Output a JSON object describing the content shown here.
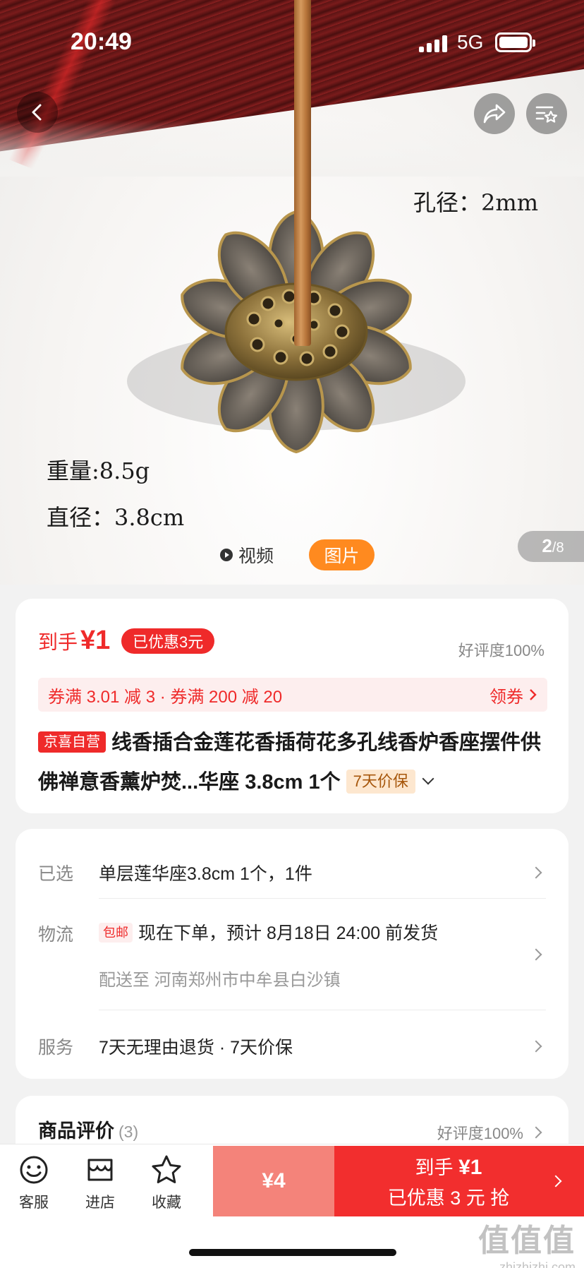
{
  "status_bar": {
    "time": "20:49",
    "network": "5G"
  },
  "hero": {
    "spec_hole": "孔径：2mm",
    "spec_weight": "重量:8.5g",
    "spec_diameter": "直径：3.8cm",
    "tab_video": "视频",
    "tab_image": "图片",
    "page_current": "2",
    "page_total": "/8"
  },
  "price": {
    "label": "到手",
    "amount": "¥1",
    "saved_badge": "已优惠3元",
    "rating": "好评度100%",
    "coupon_text": "券满 3.01 减 3 · 券满 200 减 20",
    "coupon_action": "领券",
    "store_tag": "京喜自营",
    "title": "线香插合金莲花香插荷花多孔线香炉香座摆件供佛禅意香薰炉焚...华座 3.8cm 1个",
    "guarantee_tag": "7天价保"
  },
  "info": {
    "selected_label": "已选",
    "selected_value": "单层莲华座3.8cm 1个，1件",
    "logistics_label": "物流",
    "shipping_tag": "包邮",
    "logistics_value": "现在下单，预计 8月18日 24:00 前发货",
    "delivery_to": "配送至 河南郑州市中牟县白沙镇",
    "service_label": "服务",
    "service_value": "7天无理由退货 · 7天价保"
  },
  "reviews": {
    "title": "商品评价",
    "count": "(3)",
    "rating": "好评度100%"
  },
  "bottom_bar": {
    "service": "客服",
    "store": "进店",
    "favorite": "收藏",
    "cart_price": "¥4",
    "buy_line1_label": "到手",
    "buy_line1_price": "¥1",
    "buy_line2": "已优惠 3 元 抢"
  },
  "watermark": {
    "big": "值值值",
    "small": "zhizhizhi.com"
  },
  "colors": {
    "accent_red": "#ef2a2a",
    "orange": "#ff8a1f",
    "cart_pink": "#f4837a"
  }
}
